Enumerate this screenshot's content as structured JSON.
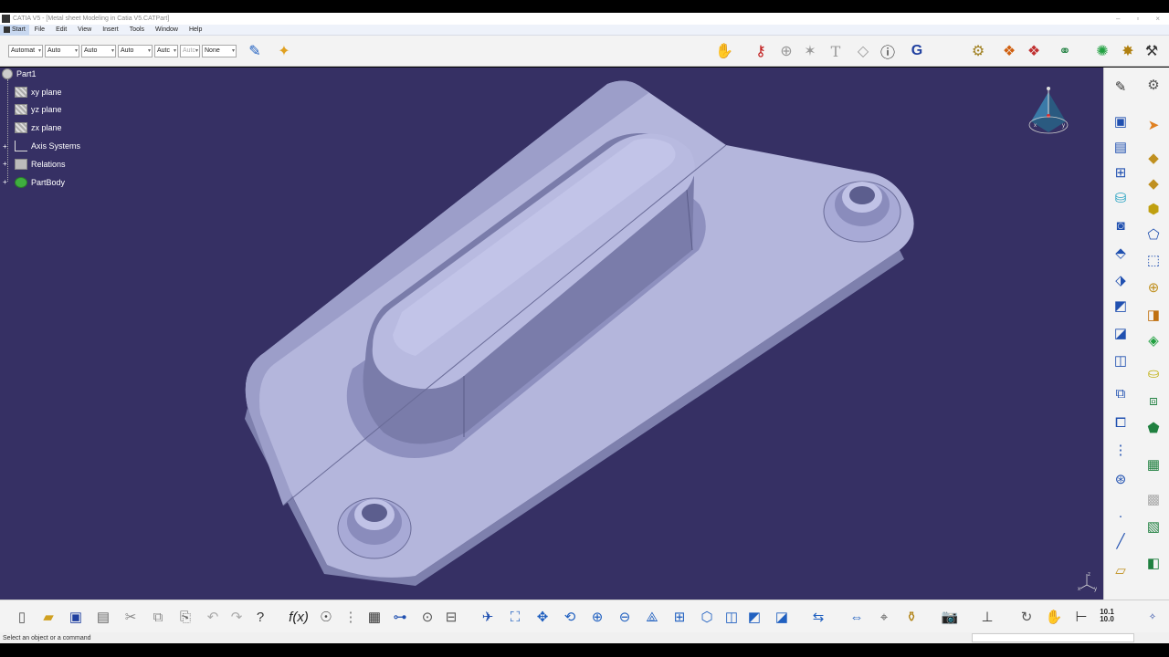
{
  "window": {
    "title": "CATIA V5 - [Metal sheet Modeling in Catia V5.CATPart]",
    "controls": [
      "–",
      "▫",
      "×"
    ]
  },
  "menu": {
    "start": "Start",
    "items": [
      "File",
      "Edit",
      "View",
      "Insert",
      "Tools",
      "Window",
      "Help"
    ]
  },
  "toolbar_top": {
    "combos": [
      {
        "label": "Automat"
      },
      {
        "label": "Auto"
      },
      {
        "label": "Auto"
      },
      {
        "label": "Auto"
      },
      {
        "label": "Autc"
      },
      {
        "label": "Autc"
      },
      {
        "label": "None"
      }
    ]
  },
  "tree": {
    "root": "Part1",
    "items": [
      "xy plane",
      "yz plane",
      "zx plane",
      "Axis Systems",
      "Relations",
      "PartBody"
    ]
  },
  "compass_axes": {
    "x": "x",
    "y": "y",
    "z": "z"
  },
  "bottom_toolbar": {
    "grid_value_top": "10.1",
    "grid_value_bottom": "10.0"
  },
  "status": {
    "text": "Select an object or a command"
  },
  "colors": {
    "viewport_bg": "#363064",
    "part_face": "#b4b6dc",
    "part_shadow": "#7e80ad"
  }
}
